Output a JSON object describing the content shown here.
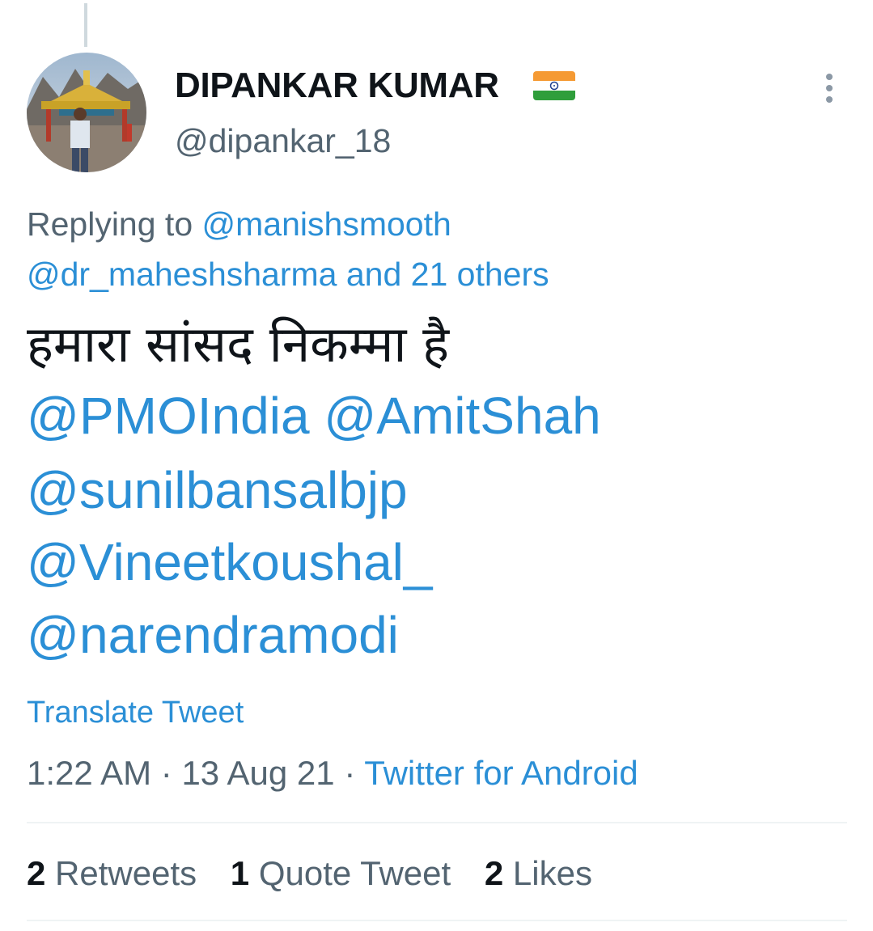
{
  "tweet": {
    "author": {
      "display_name": "DIPANKAR KUMAR",
      "flag_icon": "india-flag-icon",
      "handle": "@dipankar_18"
    },
    "replying": {
      "prefix": "Replying to",
      "first_mention": "@manishsmooth",
      "second_mention": "@dr_maheshsharma",
      "and_others": "and 21 others"
    },
    "text": "हमारा सांसद निकम्मा है",
    "mentions": {
      "line1_a": "@PMOIndia",
      "line1_b": "@AmitShah",
      "line2": "@sunilbansalbjp",
      "line3": "@Vineetkoushal_",
      "line4": "@narendramodi"
    },
    "translate_label": "Translate Tweet",
    "meta": {
      "time": "1:22 AM",
      "separator": "·",
      "date": "13 Aug 21",
      "source": "Twitter for Android"
    },
    "stats": {
      "retweets_count": "2",
      "retweets_label": "Retweets",
      "quotes_count": "1",
      "quotes_label": "Quote Tweet",
      "likes_count": "2",
      "likes_label": "Likes"
    }
  },
  "colors": {
    "link": "#2b8fd6",
    "muted": "#536471",
    "text": "#0f1419",
    "divider": "#eff3f4"
  },
  "icons": {
    "more": "more-vertical-icon",
    "flag": "india-flag-icon"
  }
}
